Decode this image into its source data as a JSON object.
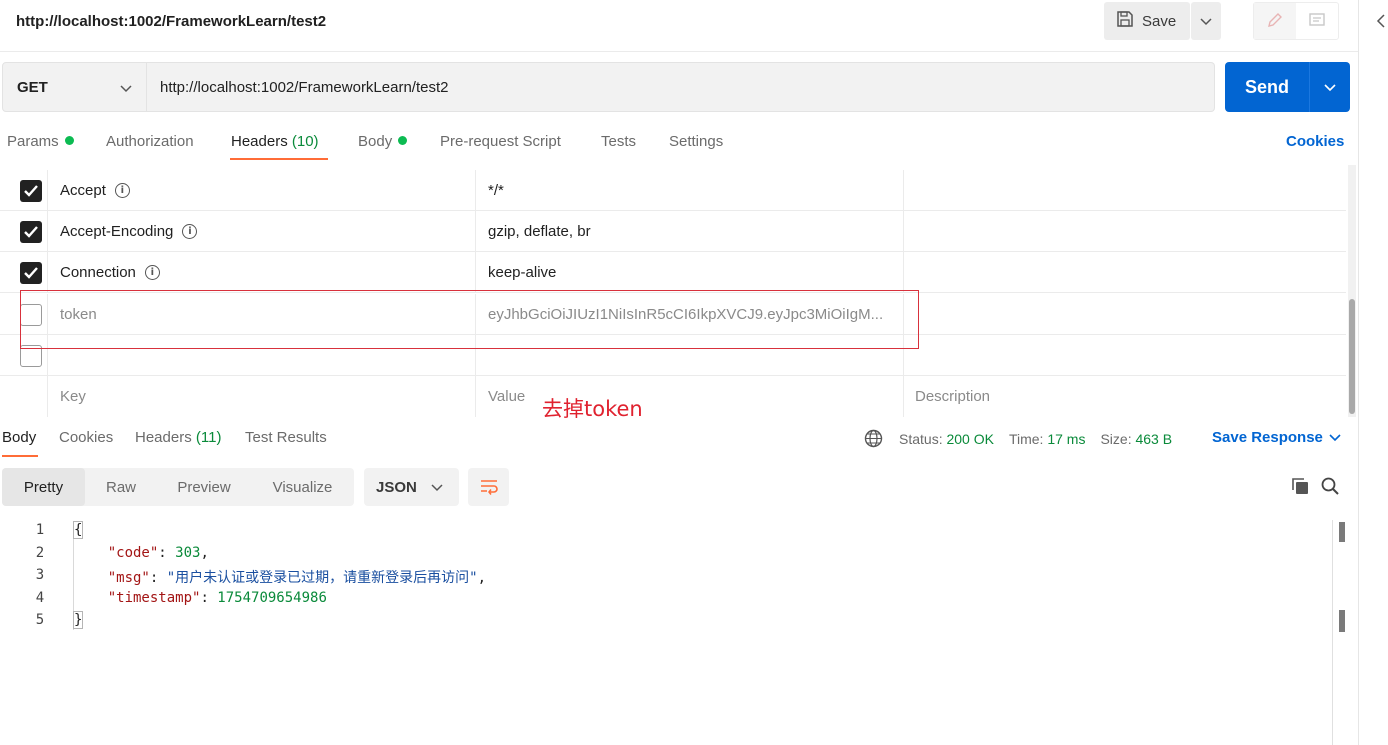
{
  "request": {
    "title": "http://localhost:1002/FrameworkLearn/test2",
    "method": "GET",
    "url": "http://localhost:1002/FrameworkLearn/test2",
    "send_label": "Send",
    "save_label": "Save"
  },
  "request_tabs": [
    {
      "label": "Params",
      "dot": true
    },
    {
      "label": "Authorization"
    },
    {
      "label": "Headers",
      "count": "(10)"
    },
    {
      "label": "Body",
      "dot": true
    },
    {
      "label": "Pre-request Script"
    },
    {
      "label": "Tests"
    },
    {
      "label": "Settings"
    }
  ],
  "cookies_link": "Cookies",
  "headers": [
    {
      "key": "Accept",
      "value": "*/*",
      "checked": true
    },
    {
      "key": "Accept-Encoding",
      "value": "gzip, deflate, br",
      "checked": true
    },
    {
      "key": "Connection",
      "value": "keep-alive",
      "checked": true
    },
    {
      "key": "token",
      "value": "eyJhbGciOiJIUzI1NiIsInR5cCI6IkpXVCJ9.eyJpc3MiOiIgM...",
      "checked": false
    },
    {
      "key": "",
      "value": "",
      "checked": false
    }
  ],
  "headers_placeholder": {
    "key": "Key",
    "value": "Value",
    "description": "Description"
  },
  "annotation": "去掉token",
  "response_tabs": [
    {
      "label": "Body"
    },
    {
      "label": "Cookies"
    },
    {
      "label": "Headers",
      "count": "(11)"
    },
    {
      "label": "Test Results"
    }
  ],
  "response_status": {
    "status_label": "Status:",
    "status_value": "200 OK",
    "time_label": "Time:",
    "time_value": "17 ms",
    "size_label": "Size:",
    "size_value": "463 B"
  },
  "save_response_label": "Save Response",
  "view_modes": [
    "Pretty",
    "Raw",
    "Preview",
    "Visualize"
  ],
  "format": "JSON",
  "response_body": {
    "line_numbers": [
      "1",
      "2",
      "3",
      "4",
      "5"
    ],
    "open_brace": "{",
    "close_brace": "}",
    "code_key": "\"code\"",
    "code_value": "303",
    "msg_key": "\"msg\"",
    "msg_value": "\"用户未认证或登录已过期，请重新登录后再访问\"",
    "timestamp_key": "\"timestamp\"",
    "timestamp_value": "1754709654986"
  },
  "colors": {
    "accent": "#ff6c37",
    "primary": "#0265d2",
    "success": "#0a8a3a",
    "annotation_red": "#d8313c"
  }
}
